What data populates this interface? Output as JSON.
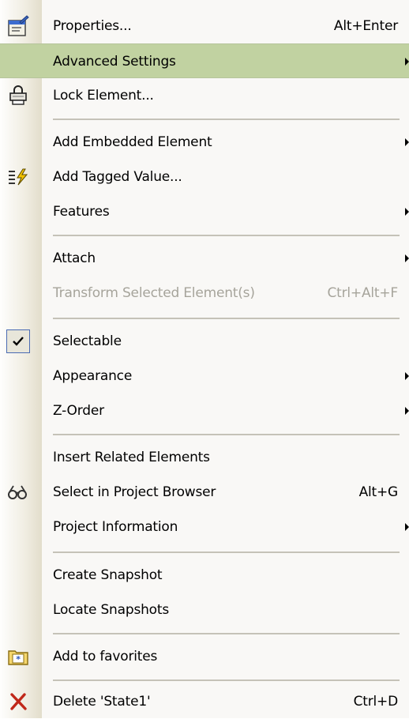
{
  "menu": {
    "items": [
      {
        "id": "properties",
        "label": "Properties...",
        "accel": "Alt+Enter",
        "icon": "properties-icon"
      },
      {
        "id": "advanced-settings",
        "label": "Advanced Settings",
        "submenu": true,
        "highlighted": true
      },
      {
        "id": "lock-element",
        "label": "Lock Element...",
        "icon": "lock-printer-icon"
      },
      {
        "id": "add-embedded-element",
        "label": "Add Embedded Element",
        "submenu": true
      },
      {
        "id": "add-tagged-value",
        "label": "Add Tagged Value...",
        "icon": "tagged-value-icon"
      },
      {
        "id": "features",
        "label": "Features",
        "submenu": true
      },
      {
        "id": "attach",
        "label": "Attach",
        "submenu": true
      },
      {
        "id": "transform",
        "label": "Transform Selected Element(s)",
        "accel": "Ctrl+Alt+F",
        "disabled": true
      },
      {
        "id": "selectable",
        "label": "Selectable",
        "checked": true,
        "icon": "checkmark-icon"
      },
      {
        "id": "appearance",
        "label": "Appearance",
        "submenu": true
      },
      {
        "id": "z-order",
        "label": "Z-Order",
        "submenu": true
      },
      {
        "id": "insert-related",
        "label": "Insert Related Elements"
      },
      {
        "id": "select-in-browser",
        "label": "Select in Project Browser",
        "accel": "Alt+G",
        "icon": "binoculars-icon"
      },
      {
        "id": "project-information",
        "label": "Project Information",
        "submenu": true
      },
      {
        "id": "create-snapshot",
        "label": "Create Snapshot"
      },
      {
        "id": "locate-snapshots",
        "label": "Locate Snapshots"
      },
      {
        "id": "add-to-favorites",
        "label": "Add to favorites",
        "icon": "favorites-folder-icon"
      },
      {
        "id": "delete",
        "label": "Delete 'State1'",
        "accel": "Ctrl+D",
        "icon": "delete-x-icon"
      }
    ]
  },
  "colors": {
    "highlight": "#c1d2a1",
    "disabled_text": "#a6a49b",
    "separator": "#c5c2b8",
    "delete_icon": "#c0281a"
  }
}
